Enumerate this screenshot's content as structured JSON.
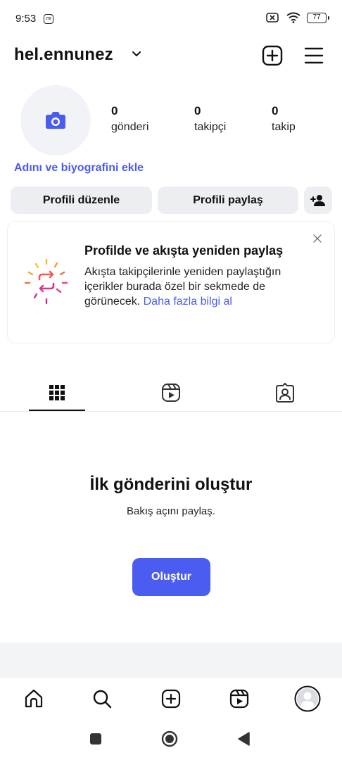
{
  "status_bar": {
    "time": "9:53",
    "left_icon": "mi",
    "battery": "77",
    "icons": [
      "notification-icon",
      "sim-x-icon",
      "wifi-icon",
      "battery-icon"
    ]
  },
  "header": {
    "username": "hel.ennunez",
    "icons": [
      "chevron-down-icon",
      "create-plus-icon",
      "menu-icon"
    ]
  },
  "profile": {
    "stats": [
      {
        "count": "0",
        "label": "gönderi"
      },
      {
        "count": "0",
        "label": "takipçi"
      },
      {
        "count": "0",
        "label": "takip"
      }
    ],
    "bio_link": "Adını ve biyografini ekle"
  },
  "actions": {
    "edit_profile": "Profili düzenle",
    "share_profile": "Profili paylaş"
  },
  "promo": {
    "title": "Profilde ve akışta yeniden paylaş",
    "body": "Akışta takipçilerinle yeniden paylaştığın içerikler burada özel bir sekmede de görünecek.",
    "link": "Daha fazla bilgi al"
  },
  "tabs": [
    "grid-icon",
    "reels-icon",
    "tagged-icon"
  ],
  "empty_state": {
    "title": "İlk gönderini oluştur",
    "subtitle": "Bakış açını paylaş.",
    "button": "Oluştur"
  },
  "bottom_nav": [
    "home-icon",
    "search-icon",
    "create-icon",
    "reels-icon",
    "profile-icon"
  ],
  "colors": {
    "accent": "#4a5df0",
    "button_bg": "#eceef1"
  }
}
